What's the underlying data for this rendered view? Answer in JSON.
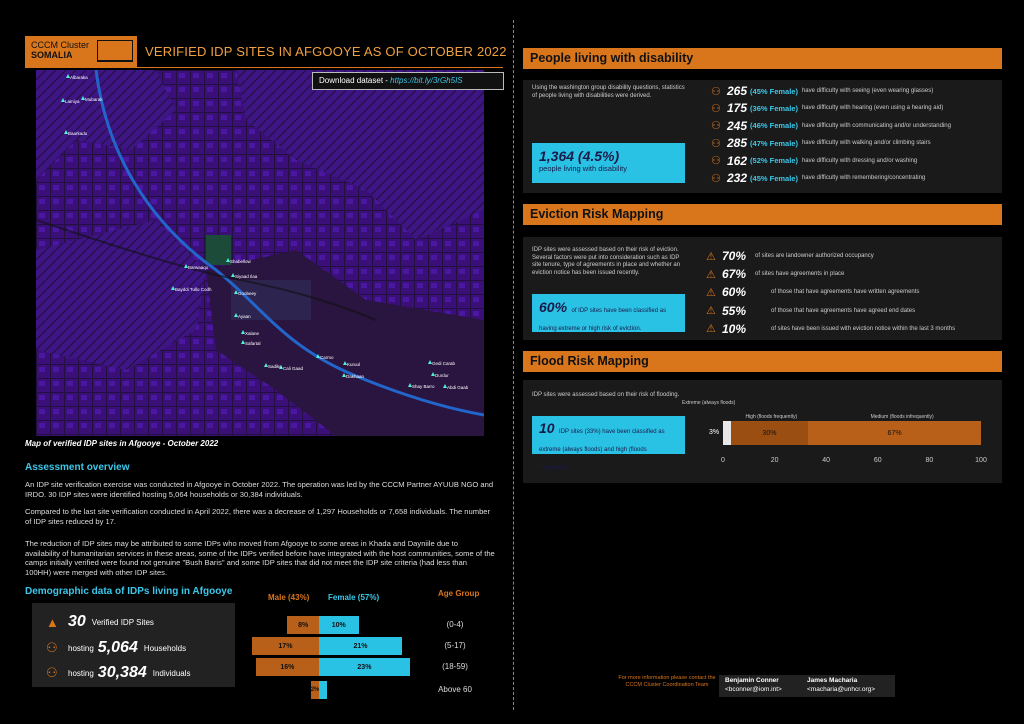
{
  "header": {
    "logo_line1": "CCCM Cluster",
    "logo_line2": "SOMALIA",
    "title": "VERIFIED IDP SITES IN AFGOOYE AS OF OCTOBER 2022",
    "download_label": "Download dataset - ",
    "download_link": "https://bit.ly/3rGh5IS"
  },
  "map": {
    "caption": "Map of verified IDP sites in Afgooye - October 2022",
    "place_labels": [
      "Albaraka",
      "Lamiya",
      "Mubarak",
      "Baarkadu",
      "Barwaaqo",
      "Bayddi Tullo Codh",
      "Shabellow",
      "Siyaad Ilaa",
      "Goobeey",
      "Ayaan",
      "Xalane",
      "Safartal",
      "Sadiko",
      "Carmo",
      "Kuruul",
      "Dakhaan",
      "Cali Gaad",
      "Gedi Carab",
      "Durdur",
      "Abdi Gaab",
      "Shay Barro"
    ]
  },
  "assessment": {
    "title": "Assessment overview",
    "p1": "An IDP site verification exercise was conducted in Afgooye in October 2022. The operation was led by the CCCM Partner AYUUB NGO and IRDO. 30 IDP sites were identified hosting 5,064 households or 30,384 individuals.",
    "p2": "Compared to the last site verification conducted in April 2022, there was a decrease of 1,297 Households or 7,658 individuals. The number of IDP sites reduced by 17.",
    "p3": "The reduction of IDP sites may be attributed to some IDPs who moved from Afgooye to some areas in Khada and Dayniile due to availability of humanitarian services in these areas, some of the IDPs verified before have integrated with the host communities, some of the camps initially verified were found not genuine \"Bush Baris\" and some IDP sites that did not meet the IDP site criteria (had less than 100HH) were merged with other IDP sites."
  },
  "demographic": {
    "title": "Demographic data of IDPs living in Afgooye",
    "sites_value": "30",
    "sites_label": "Verified IDP Sites",
    "hh_prefix": "hosting",
    "hh_value": "5,064",
    "hh_label": "Households",
    "ind_prefix": "hosting",
    "ind_value": "30,384",
    "ind_label": "Individuals",
    "male_header": "Male (43%)",
    "female_header": "Female (57%)",
    "age_header": "Age Group",
    "pyramid": [
      {
        "age": "(0-4)",
        "male": 8,
        "female": 10,
        "male_label": "8%",
        "female_label": "10%"
      },
      {
        "age": "(5-17)",
        "male": 17,
        "female": 21,
        "male_label": "17%",
        "female_label": "21%"
      },
      {
        "age": "(18-59)",
        "male": 16,
        "female": 23,
        "male_label": "16%",
        "female_label": "23%"
      },
      {
        "age": "Above 60",
        "male": 2,
        "female": 2,
        "male_label": "2%",
        "female_label": "2%"
      }
    ]
  },
  "disability": {
    "title": "People living with disability",
    "intro": "Using the washington group disability questions, statistics of people living with disabilities were derived.",
    "total_value": "1,364 (4.5%)",
    "total_label": "people living with disability",
    "items": [
      {
        "value": "265",
        "female": "(45% Female)",
        "text": "have difficulty with seeing (even wearing glasses)"
      },
      {
        "value": "175",
        "female": "(36% Female)",
        "text": "have difficulty with hearing (even using a hearing aid)"
      },
      {
        "value": "245",
        "female": "(46% Female)",
        "text": "have difficulty with communicating and/or understanding"
      },
      {
        "value": "285",
        "female": "(47% Female)",
        "text": "have difficulty with walking and/or climbing stairs"
      },
      {
        "value": "162",
        "female": "(52% Female)",
        "text": "have difficulty with dressing and/or washing"
      },
      {
        "value": "232",
        "female": "(45% Female)",
        "text": "have difficulty with remembering/concentrating"
      }
    ]
  },
  "eviction": {
    "title": "Eviction Risk Mapping",
    "intro": "IDP sites were assessed based on their risk of eviction. Several factors were put into consideration such as IDP site tenure, type of agreements in place and whether an eviction notice has been issued recently.",
    "box_value": "60%",
    "box_text": "of IDP sites have been classified as having extreme or high risk of eviction.",
    "items": [
      {
        "value": "70%",
        "text": "of sites are landowner authorized occupancy"
      },
      {
        "value": "67%",
        "text": "of sites have agreements in place"
      },
      {
        "value": "60%",
        "text": "of those that have agreements have written agreements"
      },
      {
        "value": "55%",
        "text": "of those that have agreements have agreed end dates"
      },
      {
        "value": "10%",
        "text": "of sites have been issued with eviction notice within the last 3 months"
      }
    ]
  },
  "flood": {
    "title": "Flood Risk Mapping",
    "intro": "IDP sites were assessed based on their risk of flooding.",
    "box_value": "10",
    "box_text": "IDP sites (33%) have been classified as extreme (always floods) and high (floods frequently)."
  },
  "chart_data": {
    "type": "bar",
    "orientation": "horizontal-stacked",
    "series": [
      {
        "name": "Extreme (always floods)",
        "value": 3,
        "label": "3%",
        "color": "#e8e8e8"
      },
      {
        "name": "High (floods frequently)",
        "value": 30,
        "label": "30%",
        "color": "#9a4e12"
      },
      {
        "name": "Medium (floods infrequently)",
        "value": 67,
        "label": "67%",
        "color": "#b8601a"
      }
    ],
    "xticks": [
      "0",
      "20",
      "40",
      "60",
      "80",
      "100"
    ],
    "xlim": [
      0,
      100
    ]
  },
  "footer": {
    "more_info": "For more information please contact the CCCM Cluster Coordination Team",
    "contact1_name": "Benjamin Conner",
    "contact1_email": "<bconner@iom.int>",
    "contact2_name": "James Macharia",
    "contact2_email": "<macharia@unhcr.org>"
  },
  "colors": {
    "accent": "#d9761c",
    "cyan": "#29c2e4",
    "map_purple": "#2d0a5e"
  }
}
